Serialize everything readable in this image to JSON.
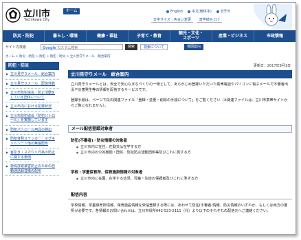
{
  "header": {
    "logo_title": "立川市",
    "logo_sub": "Tachikawa City",
    "home_label": "ホーム",
    "languages": [
      "English",
      "中文(簡体字)",
      "한국어"
    ],
    "utilities": [
      "文字サイズ・色合い変更",
      "音声読み上げ"
    ]
  },
  "nav": {
    "items": [
      "防災・防犯",
      "暮らし・環境",
      "健康・福祉",
      "子育て・教育",
      "観光・文化・スポーツ",
      "産業・ビジネス",
      "市政情報"
    ]
  },
  "search": {
    "label": "サイト内検索",
    "placeholder": "カスタム検索",
    "google": "Google",
    "button": "検索",
    "about": "検索について",
    "map_button": "地図案内"
  },
  "breadcrumb": "ホーム > 防災・防犯 > 防犯 > 防犯・防災 > 立川見守りメール　総合案内",
  "sidebar": {
    "heading": "防犯・防災",
    "items": [
      "立川見守りメール　総合案内",
      "立川見守りメール　配信件数",
      "立川市防犯協会・防止活動をしている団体について",
      "立川市内における犯罪状況",
      "立川市防犯協会「防犯パトロール」を実施しています",
      "防犯パトロール用具の貸出",
      "防犯啓発ステッカー・マグネットシート他の無償配布",
      "客引き・スカウト行為の防止に関する条例",
      "特殊詐欺被害防止のための自動通話録音機の配布"
    ]
  },
  "main": {
    "updated": "更新日：2017年9月1日",
    "title": "立川見守りメール　総合案内",
    "para1": "立川見守りメールとは、安全で安心なまちづくりの一環として、あらかじめ登録いただいた携帯電話やパソコンに電子メールで不審者出没や災害発生等の情報を配信するサービスです。",
    "para2": "登録手順は、ページ下段の関連ファイル「登録・変更・削除の手順について」をご覧ください（※関連ファイルは、立川市携帯サイトからご覧になれません）。",
    "section_heading": "メール配信登録対象者",
    "group1_heading": "防犯(不審者)・防災情報の対象者",
    "group1_items": [
      "立川市内に在住、在勤又は在学する方",
      "立川市内の公的機関・団体、防犯防災活動団体等及びこれに属する方"
    ],
    "group2_heading": "学校・学童保育所、保育施設情報の対象者",
    "group2_items": [
      "立川市内に在園、在学する幼児、児童・生徒の保護者及びこれに準ずる方"
    ],
    "delivery_heading": "配信内容",
    "para3": "学校情報、学童保育所情報、保育施設情報を受信登録する際には、あわせて防犯(不審者)情報、防災情報のいずれか、もしくは両方の選択が必要です。各情報のお問い合わせは、立川市役所042-523-2111（代）より以下のそれぞれの配信元へご連絡ください。"
  }
}
